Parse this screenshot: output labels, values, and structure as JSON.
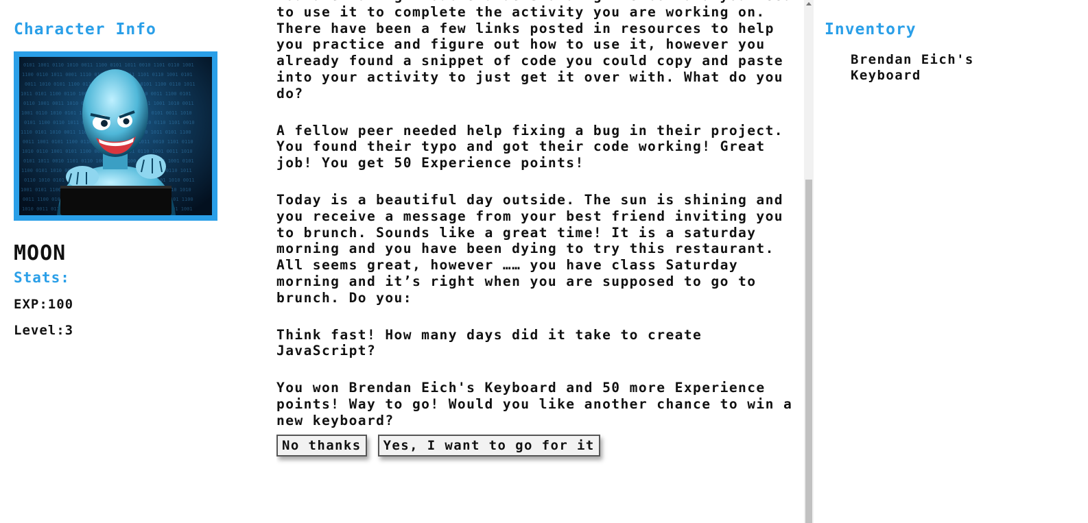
{
  "character": {
    "section_title": "Character Info",
    "name": "MOON",
    "stats_title": "Stats:",
    "exp": "EXP:100",
    "level": "Level:3",
    "avatar_icon": "robot-hacker-avatar"
  },
  "story": {
    "paragraphs": [
      "You are having trouble understanding flexbox and you need to use it to complete the activity you are working on. There have been a few links posted in resources to help you practice and figure out how to use it, however you already found a snippet of code you could copy and paste into your activity to just get it over with. What do you do?",
      "A fellow peer needed help fixing a bug in their project. You found their typo and got their code working! Great job! You get 50 Experience points!",
      "Today is a beautiful day outside. The sun is shining and you receive a message from your best friend inviting you to brunch. Sounds like a great time! It is a saturday morning and you have been dying to try this restaurant. All seems great, however …… you have class Saturday morning and it’s right when you are supposed to go to brunch. Do you:",
      "Think fast! How many days did it take to create JavaScript?",
      "You won Brendan Eich's Keyboard and 50 more Experience points! Way to go! Would you like another chance to win a new keyboard?"
    ],
    "buttons": {
      "no": "No thanks",
      "yes": "Yes, I want to go for it"
    }
  },
  "inventory": {
    "title": "Inventory",
    "items": [
      "Brendan Eich's Keyboard"
    ]
  },
  "colors": {
    "accent": "#2a9fe8",
    "text": "#111111"
  }
}
